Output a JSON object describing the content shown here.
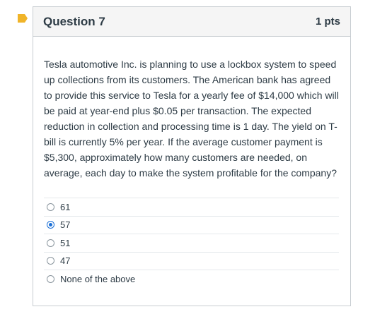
{
  "question": {
    "title": "Question 7",
    "points": "1 pts",
    "text": "Tesla automotive Inc. is planning to use a lockbox system to speed up collections from its customers. The American bank has agreed to provide this service to Tesla for a yearly fee of $14,000 which will be paid at year-end plus $0.05 per transaction. The expected reduction in collection and processing time is 1 day. The yield on T-bill is currently 5% per year. If the average customer payment is $5,300, approximately how many customers are needed, on average, each day to make the system profitable for the company?"
  },
  "answers": [
    {
      "label": "61",
      "selected": false
    },
    {
      "label": "57",
      "selected": true
    },
    {
      "label": "51",
      "selected": false
    },
    {
      "label": "47",
      "selected": false
    },
    {
      "label": "None of the above",
      "selected": false
    }
  ],
  "colors": {
    "flag": "#f0b429",
    "selected_radio": "#1b6fd6",
    "header_bg": "#f5f5f5",
    "border": "#c7cdd1"
  },
  "icons": {
    "flag": "flag-icon"
  }
}
